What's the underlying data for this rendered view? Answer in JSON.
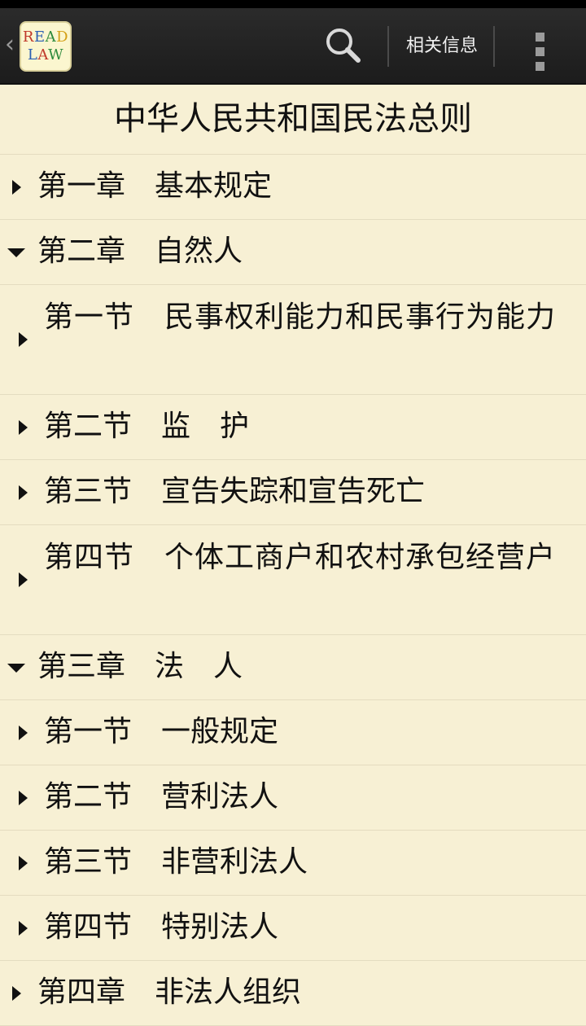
{
  "action_bar": {
    "logo_line1": [
      "R",
      "E",
      "A",
      "D"
    ],
    "logo_line2": [
      "L",
      "A",
      "W"
    ],
    "logo_colors": [
      "#c0392b",
      "#2c5fb3",
      "#2e8b3e",
      "#d4a017",
      "#2c5fb3",
      "#c0392b",
      "#2e8b3e"
    ],
    "search_icon": "magnifier-icon",
    "info_label": "相关信息",
    "overflow_icon": "more-vertical-icon",
    "back_icon": "chevron-left-icon",
    "background": "#222222"
  },
  "page": {
    "title": "中华人民共和国民法总则",
    "background": "#f7f0d4"
  },
  "toc": [
    {
      "label": "第一章　基本规定",
      "expanded": false,
      "level": 1
    },
    {
      "label": "第二章　自然人",
      "expanded": true,
      "level": 1
    },
    {
      "label": "第一节　民事权利能力和民事行为能力",
      "expanded": false,
      "level": 2
    },
    {
      "label": "第二节　监　护",
      "expanded": false,
      "level": 2
    },
    {
      "label": "第三节　宣告失踪和宣告死亡",
      "expanded": false,
      "level": 2
    },
    {
      "label": "第四节　个体工商户和农村承包经营户",
      "expanded": false,
      "level": 2
    },
    {
      "label": "第三章　法　人",
      "expanded": true,
      "level": 1
    },
    {
      "label": "第一节　一般规定",
      "expanded": false,
      "level": 2
    },
    {
      "label": "第二节　营利法人",
      "expanded": false,
      "level": 2
    },
    {
      "label": "第三节　非营利法人",
      "expanded": false,
      "level": 2
    },
    {
      "label": "第四节　特别法人",
      "expanded": false,
      "level": 2
    },
    {
      "label": "第四章　非法人组织",
      "expanded": false,
      "level": 1
    }
  ]
}
